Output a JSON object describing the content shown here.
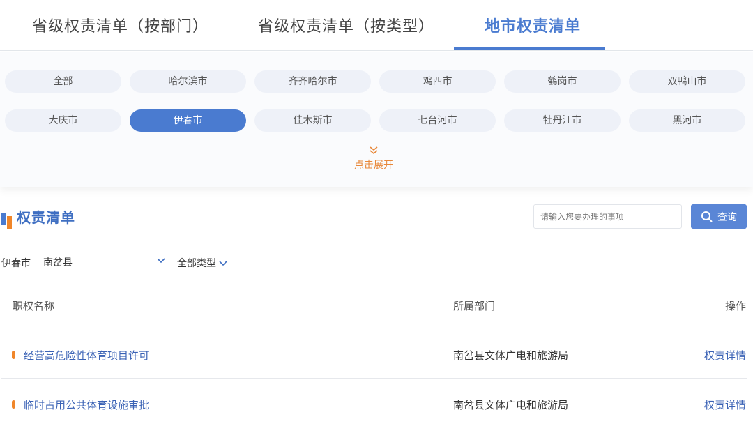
{
  "tabs": [
    {
      "label": "省级权责清单（按部门）"
    },
    {
      "label": "省级权责清单（按类型）"
    },
    {
      "label": "地市权责清单"
    }
  ],
  "active_tab": "地市权责清单",
  "cities": [
    {
      "label": "全部"
    },
    {
      "label": "哈尔滨市"
    },
    {
      "label": "齐齐哈尔市"
    },
    {
      "label": "鸡西市"
    },
    {
      "label": "鹤岗市"
    },
    {
      "label": "双鸭山市"
    },
    {
      "label": "大庆市"
    },
    {
      "label": "伊春市"
    },
    {
      "label": "佳木斯市"
    },
    {
      "label": "七台河市"
    },
    {
      "label": "牡丹江市"
    },
    {
      "label": "黑河市"
    }
  ],
  "active_city": "伊春市",
  "expand_label": "点击展开",
  "section": {
    "title": "权责清单"
  },
  "search": {
    "placeholder": "请输入您要办理的事项",
    "button_label": "查询"
  },
  "filters": {
    "city": "伊春市",
    "county": "南岔县",
    "type": "全部类型"
  },
  "table": {
    "headers": [
      "职权名称",
      "所属部门",
      "操作"
    ],
    "rows": [
      {
        "name": "经营高危险性体育项目许可",
        "dept": "南岔县文体广电和旅游局",
        "op": "权责详情"
      },
      {
        "name": "临时占用公共体育设施审批",
        "dept": "南岔县文体广电和旅游局",
        "op": "权责详情"
      }
    ]
  },
  "colors": {
    "accent": "#4a7bd0",
    "orange": "#f0862a",
    "pill_bg": "#eef1f8"
  }
}
